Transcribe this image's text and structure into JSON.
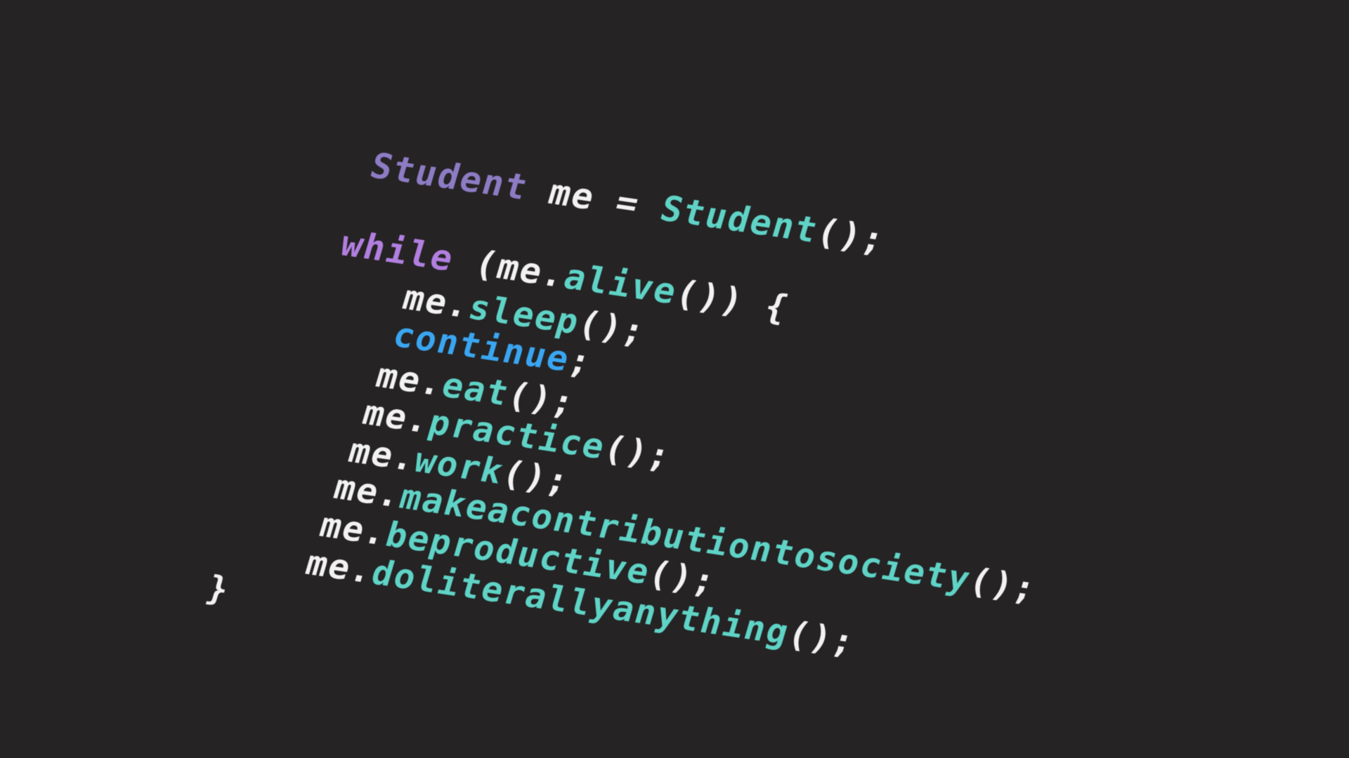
{
  "colors": {
    "background": "#252324",
    "type": "#8d7cc4",
    "keyword": "#b27fe0",
    "method": "#5fd3c6",
    "control": "#3aa6f2",
    "plain": "#f2f2f2"
  },
  "code": {
    "line1": {
      "type": "Student",
      "var": " me = ",
      "ctor": "Student",
      "punct": "();"
    },
    "line2": {
      "keyword": "while",
      "open": " (me.",
      "method": "alive",
      "close": "()) {"
    },
    "line3": {
      "obj": "me.",
      "method": "sleep",
      "punct": "();"
    },
    "line4": {
      "keyword": "continue",
      "punct": ";"
    },
    "line5": {
      "obj": "me.",
      "method": "eat",
      "punct": "();"
    },
    "line6": {
      "obj": "me.",
      "method": "practice",
      "punct": "();"
    },
    "line7": {
      "obj": "me.",
      "method": "work",
      "punct": "();"
    },
    "line8": {
      "obj": "me.",
      "method": "makeacontributiontosociety",
      "punct": "();"
    },
    "line9": {
      "obj": "me.",
      "method": "beproductive",
      "punct": "();"
    },
    "line10": {
      "obj": "me.",
      "method": "doliterallyanything",
      "punct": "();"
    },
    "line11": {
      "brace": "}"
    }
  }
}
